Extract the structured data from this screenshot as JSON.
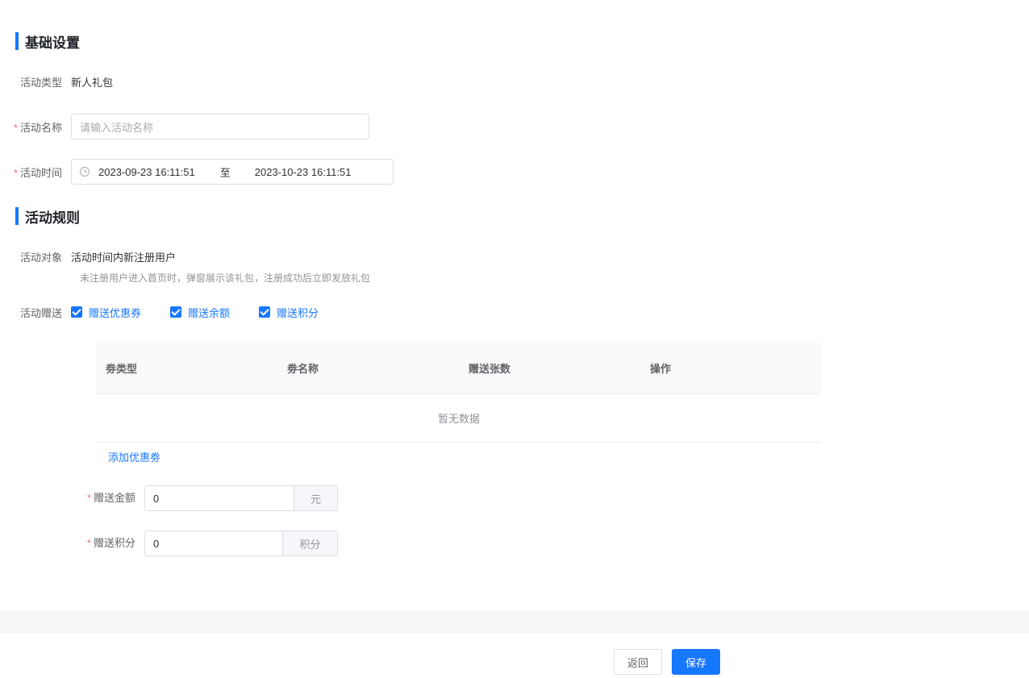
{
  "sections": {
    "basic": "基础设置",
    "rules": "活动规则"
  },
  "basic": {
    "type_label": "活动类型",
    "type_value": "新人礼包",
    "name_label": "活动名称",
    "name_placeholder": "请输入活动名称",
    "time_label": "活动时间",
    "time_start": "2023-09-23 16:11:51",
    "time_sep": "至",
    "time_end": "2023-10-23 16:11:51"
  },
  "rules": {
    "target_label": "活动对象",
    "target_value": "活动时间内新注册用户",
    "target_hint": "未注册用户进入首页时，弹窗展示该礼包，注册成功后立即发放礼包",
    "gift_label": "活动赠送",
    "gift_options": [
      "赠送优惠券",
      "赠送余额",
      "赠送积分"
    ]
  },
  "coupon_table": {
    "headers": [
      "劵类型",
      "劵名称",
      "赠送张数",
      "操作"
    ],
    "empty_text": "暂无数据",
    "add_link": "添加优惠劵"
  },
  "amount": {
    "label": "赠送金额",
    "value": "0",
    "unit": "元"
  },
  "points": {
    "label": "赠送积分",
    "value": "0",
    "unit": "积分"
  },
  "footer": {
    "back_label": "返回",
    "save_label": "保存"
  },
  "colors": {
    "accent": "#1677ff",
    "required": "#f56c6c"
  }
}
